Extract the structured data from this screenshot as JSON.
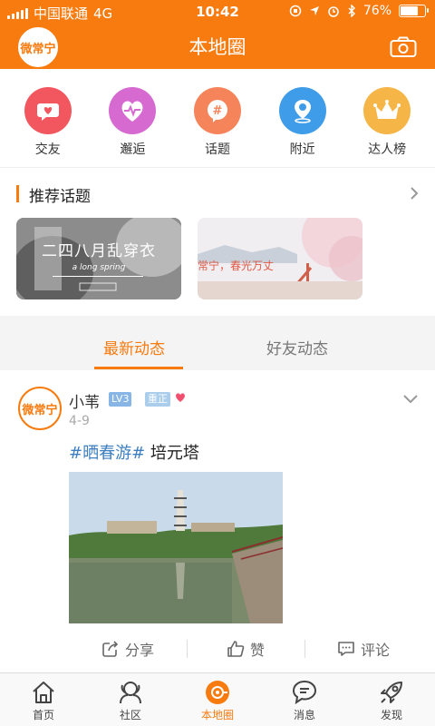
{
  "status_bar": {
    "carrier": "中国联通",
    "network": "4G",
    "time": "10:42",
    "battery": "76%",
    "battery_level": 0.76
  },
  "header": {
    "title": "本地圈",
    "logo_text": "微常宁"
  },
  "categories": [
    {
      "label": "交友",
      "color": "#f2565e"
    },
    {
      "label": "邂逅",
      "color": "#d66ad1"
    },
    {
      "label": "话题",
      "color": "#f5845a"
    },
    {
      "label": "附近",
      "color": "#3f9ce8"
    },
    {
      "label": "达人榜",
      "color": "#f5b547"
    }
  ],
  "recommended": {
    "title": "推荐话题",
    "cards": [
      {
        "text": "二四八月乱穿衣",
        "sub": "a long spring"
      },
      {
        "text": "常宁，春光万丈"
      }
    ]
  },
  "feed_tabs": {
    "latest": "最新动态",
    "friends": "好友动态"
  },
  "post": {
    "avatar_text": "微常宁",
    "username": "小苇",
    "level": "LV3",
    "verified": "重正",
    "date": "4-9",
    "hashtag": "#晒春游#",
    "text": " 培元塔",
    "actions": {
      "share": "分享",
      "like": "赞",
      "comment": "评论"
    }
  },
  "bottom_nav": [
    {
      "label": "首页",
      "icon": "home-icon"
    },
    {
      "label": "社区",
      "icon": "community-icon"
    },
    {
      "label": "本地圈",
      "icon": "local-circle-icon"
    },
    {
      "label": "消息",
      "icon": "message-icon"
    },
    {
      "label": "发现",
      "icon": "rocket-icon"
    }
  ],
  "colors": {
    "accent": "#f77b0f",
    "tag_blue": "#3e7fc1"
  }
}
